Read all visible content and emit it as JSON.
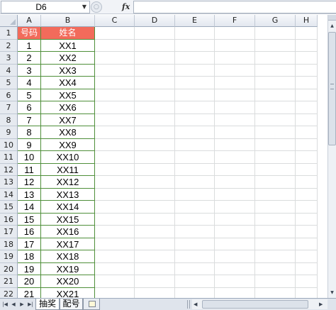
{
  "formula_bar": {
    "name_box": "D6",
    "dropdown_glyph": "▼",
    "round_glyph": "○",
    "fx_label": "fx",
    "formula_value": ""
  },
  "columns": [
    "A",
    "B",
    "C",
    "D",
    "E",
    "F",
    "G",
    "H"
  ],
  "rows": [
    "1",
    "2",
    "3",
    "4",
    "5",
    "6",
    "7",
    "8",
    "9",
    "10",
    "11",
    "12",
    "13",
    "14",
    "15",
    "16",
    "17",
    "18",
    "19",
    "20",
    "21",
    "22"
  ],
  "table": {
    "headers": [
      "号码",
      "姓名"
    ],
    "entries": [
      [
        "1",
        "XX1"
      ],
      [
        "2",
        "XX2"
      ],
      [
        "3",
        "XX3"
      ],
      [
        "4",
        "XX4"
      ],
      [
        "5",
        "XX5"
      ],
      [
        "6",
        "XX6"
      ],
      [
        "7",
        "XX7"
      ],
      [
        "8",
        "XX8"
      ],
      [
        "9",
        "XX9"
      ],
      [
        "10",
        "XX10"
      ],
      [
        "11",
        "XX11"
      ],
      [
        "12",
        "XX12"
      ],
      [
        "13",
        "XX13"
      ],
      [
        "14",
        "XX14"
      ],
      [
        "15",
        "XX15"
      ],
      [
        "16",
        "XX16"
      ],
      [
        "17",
        "XX17"
      ],
      [
        "18",
        "XX18"
      ],
      [
        "19",
        "XX19"
      ],
      [
        "20",
        "XX20"
      ],
      [
        "21",
        "XX21"
      ]
    ]
  },
  "sheet_tabs": [
    "抽奖",
    "配号"
  ],
  "active_tab": 0,
  "sheet_nav": [
    "|◀",
    "◀",
    "▶",
    "▶|"
  ],
  "scroll_glyphs": {
    "up": "▲",
    "down": "▼",
    "left": "◀",
    "right": "▶"
  },
  "colors": {
    "header_fill": "#f26b5b",
    "header_text": "#ffffff",
    "table_border": "#4f8f3a",
    "gridline": "#dadcdd"
  },
  "icons": {
    "name_box_dropdown": "chevron-down-icon",
    "function": "fx-icon",
    "new_sheet": "insert-sheet-icon"
  }
}
